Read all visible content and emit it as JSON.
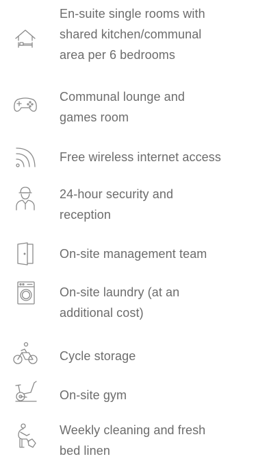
{
  "features": [
    {
      "icon": "house-bed-icon",
      "label": "En-suite single rooms with\nshared kitchen/communal\narea per 6 bedrooms"
    },
    {
      "icon": "game-controller-icon",
      "label": "Communal lounge and\ngames room"
    },
    {
      "icon": "wifi-icon",
      "label": "Free wireless internet access"
    },
    {
      "icon": "security-guard-icon",
      "label": "24-hour security and\nreception"
    },
    {
      "icon": "door-icon",
      "label": "On-site management team"
    },
    {
      "icon": "washing-machine-icon",
      "label": "On-site laundry (at an\nadditional cost)"
    },
    {
      "icon": "bicycle-icon",
      "label": "Cycle storage"
    },
    {
      "icon": "exercise-bike-icon",
      "label": "On-site gym"
    },
    {
      "icon": "cleaning-icon",
      "label": "Weekly cleaning and fresh\nbed linen"
    }
  ]
}
